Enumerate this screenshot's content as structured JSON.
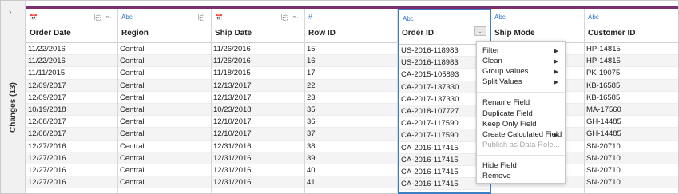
{
  "changes_panel": {
    "chevron": "›",
    "label": "Changes (13)"
  },
  "type_icons": {
    "date": "📅",
    "string": "Abc",
    "number": "#"
  },
  "columns": [
    {
      "name": "Order Date",
      "type": "date",
      "actions": "⎘ ∿",
      "values": [
        "11/22/2016",
        "11/22/2016",
        "11/11/2015",
        "12/09/2017",
        "12/09/2017",
        "10/19/2018",
        "12/08/2017",
        "12/08/2017",
        "12/27/2016",
        "12/27/2016",
        "12/27/2016",
        "12/27/2016"
      ]
    },
    {
      "name": "Region",
      "type": "string",
      "actions": "⎘",
      "values": [
        "Central",
        "Central",
        "Central",
        "Central",
        "Central",
        "Central",
        "Central",
        "Central",
        "Central",
        "Central",
        "Central",
        "Central"
      ]
    },
    {
      "name": "Ship Date",
      "type": "date",
      "actions": "⎘ ∿",
      "values": [
        "11/26/2016",
        "11/26/2016",
        "11/18/2015",
        "12/13/2017",
        "12/13/2017",
        "10/23/2018",
        "12/10/2017",
        "12/10/2017",
        "12/31/2016",
        "12/31/2016",
        "12/31/2016",
        "12/31/2016"
      ]
    },
    {
      "name": "Row ID",
      "type": "number",
      "actions": "",
      "values": [
        "15",
        "16",
        "17",
        "22",
        "23",
        "35",
        "36",
        "37",
        "38",
        "39",
        "40",
        "41"
      ]
    },
    {
      "name": "Order ID",
      "type": "string",
      "actions": "",
      "selected": true,
      "more_button": "...",
      "values": [
        "US-2016-118983",
        "US-2016-118983",
        "CA-2015-105893",
        "CA-2017-137330",
        "CA-2017-137330",
        "CA-2018-107727",
        "CA-2017-117590",
        "CA-2017-117590",
        "CA-2016-117415",
        "CA-2016-117415",
        "CA-2016-117415",
        "CA-2016-117415"
      ]
    },
    {
      "name": "Ship Mode",
      "type": "string",
      "actions": "",
      "values": [
        "",
        "",
        "",
        "",
        "",
        "",
        "",
        "",
        "",
        "",
        "",
        "Standard Class"
      ]
    },
    {
      "name": "Customer ID",
      "type": "string",
      "actions": "",
      "values": [
        "HP-14815",
        "HP-14815",
        "PK-19075",
        "KB-16585",
        "KB-16585",
        "MA-17560",
        "GH-14485",
        "GH-14485",
        "SN-20710",
        "SN-20710",
        "SN-20710",
        "SN-20710"
      ]
    }
  ],
  "context_menu": {
    "items": [
      {
        "label": "Filter",
        "submenu": true
      },
      {
        "label": "Clean",
        "submenu": true
      },
      {
        "label": "Group Values",
        "submenu": true
      },
      {
        "label": "Split Values",
        "submenu": true
      },
      {
        "label": "Rename Field"
      },
      {
        "label": "Duplicate Field"
      },
      {
        "label": "Keep Only Field"
      },
      {
        "label": "Create Calculated Field",
        "submenu": true
      },
      {
        "label": "Publish as Data Role...",
        "disabled": true
      },
      {
        "label": "Hide Field"
      },
      {
        "label": "Remove"
      }
    ],
    "arrow": "▶"
  },
  "colors": {
    "accent_bar": "#7b2f6f",
    "selection": "#3b7fc4",
    "type_icon": "#2f76c0"
  }
}
